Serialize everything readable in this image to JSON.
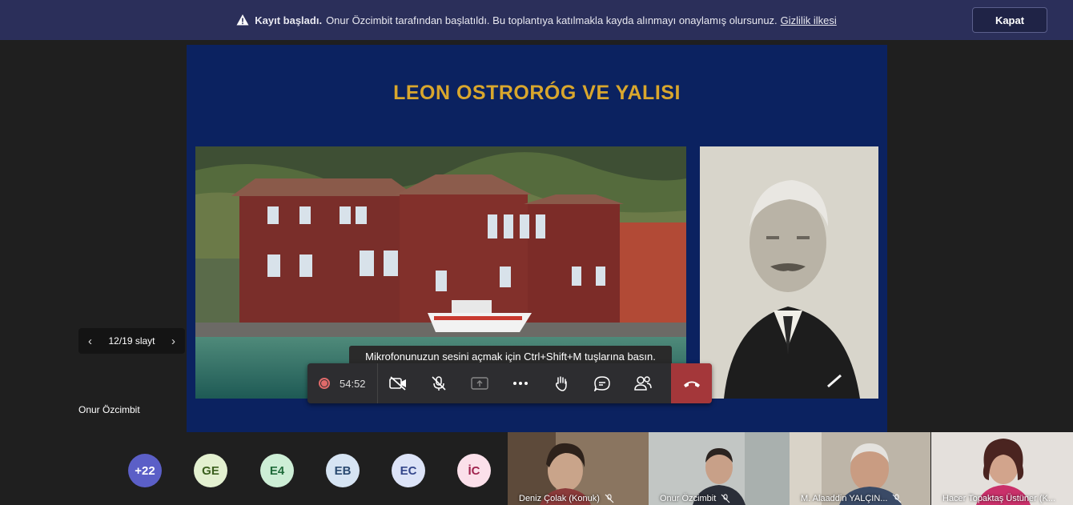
{
  "banner": {
    "bold": "Kayıt başladı.",
    "message": "Onur Özcimbit tarafından başlatıldı. Bu toplantıya katılmakla kayda alınmayı onaylamış olursunuz.",
    "link": "Gizlilik ilkesi",
    "close": "Kapat"
  },
  "slide": {
    "title": "LEON OSTRORÓG VE YALISI",
    "counter": "12/19 slayt"
  },
  "presenter": {
    "name": "Onur Özcimbit"
  },
  "tooltip": "Mikrofonunuzun sesini açmak için Ctrl+Shift+M tuşlarına basın.",
  "controls": {
    "timer": "54:52",
    "icons": [
      "record-icon",
      "camera-off-icon",
      "mic-off-icon",
      "share-icon",
      "more-icon",
      "raise-hand-icon",
      "chat-icon",
      "participants-icon",
      "hang-up-icon"
    ]
  },
  "participants": {
    "avatars": [
      {
        "label": "+22",
        "bg": "#5b5fc7",
        "fg": "#ffffff"
      },
      {
        "label": "GE",
        "bg": "#e3f0d0",
        "fg": "#3b5f1e"
      },
      {
        "label": "E4",
        "bg": "#cdeed6",
        "fg": "#1f6b3a"
      },
      {
        "label": "EB",
        "bg": "#d6e4f3",
        "fg": "#2a4a70"
      },
      {
        "label": "EC",
        "bg": "#dce3f7",
        "fg": "#34468a"
      },
      {
        "label": "İC",
        "bg": "#fbe0ea",
        "fg": "#a0244e"
      }
    ],
    "videos": [
      {
        "name": "Deniz Çolak (Konuk)"
      },
      {
        "name": "Onur Özcimbit"
      },
      {
        "name": "M. Alaaddin YALÇIN..."
      },
      {
        "name": "Hacer Topaktaş Üstüner (K..."
      }
    ]
  },
  "colors": {
    "banner": "#2b2f5a",
    "slide_bg": "#0b2260",
    "title": "#d9a72d",
    "hangup": "#a4373a"
  }
}
